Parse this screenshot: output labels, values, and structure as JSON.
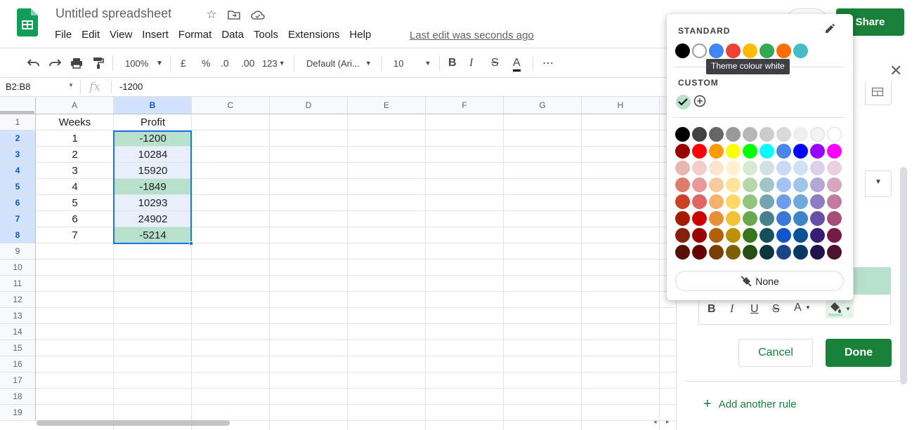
{
  "header": {
    "title": "Untitled spreadsheet",
    "menu": [
      "File",
      "Edit",
      "View",
      "Insert",
      "Format",
      "Data",
      "Tools",
      "Extensions",
      "Help"
    ],
    "last_edit": "Last edit was seconds ago",
    "share_label": "Share"
  },
  "toolbar": {
    "zoom": "100%",
    "currency": "£",
    "percent": "%",
    "dec_decrease": ".0",
    "dec_increase": ".00",
    "format_more": "123",
    "font": "Default (Ari...",
    "font_size": "10",
    "bold": "B",
    "italic": "I",
    "strike": "S",
    "text_color": "A",
    "more": "⋯"
  },
  "formula_bar": {
    "name_box": "B2:B8",
    "fx": "fx",
    "value": "-1200"
  },
  "grid": {
    "columns": [
      "A",
      "B",
      "C",
      "D",
      "E",
      "F",
      "G",
      "H"
    ],
    "rows": [
      "1",
      "2",
      "3",
      "4",
      "5",
      "6",
      "7",
      "8",
      "9",
      "10",
      "11",
      "12",
      "13",
      "14",
      "15",
      "16",
      "17",
      "18",
      "19"
    ],
    "col_a": [
      "Weeks",
      "1",
      "2",
      "3",
      "4",
      "5",
      "6",
      "7"
    ],
    "col_b": [
      "Profit",
      "-1200",
      "10284",
      "15920",
      "-1849",
      "10293",
      "24902",
      "-5214"
    ],
    "b_highlight": [
      true,
      false,
      false,
      true,
      false,
      false,
      true
    ]
  },
  "picker": {
    "standard_label": "STANDARD",
    "custom_label": "CUSTOM",
    "tooltip": "Theme colour white",
    "none_label": "None",
    "standard_colors": [
      "#000000",
      "#ffffff",
      "#4285f4",
      "#ea4335",
      "#fbbc04",
      "#34a853",
      "#ff6d01",
      "#46bdc6"
    ],
    "custom_colors": [
      "#b7e1cd"
    ],
    "palette": [
      [
        "#000000",
        "#434343",
        "#666666",
        "#999999",
        "#b7b7b7",
        "#cccccc",
        "#d9d9d9",
        "#efefef",
        "#f3f3f3",
        "#ffffff"
      ],
      [
        "#980000",
        "#ff0000",
        "#ff9900",
        "#ffff00",
        "#00ff00",
        "#00ffff",
        "#4a86e8",
        "#0000ff",
        "#9900ff",
        "#ff00ff"
      ],
      [
        "#e6b8af",
        "#f4cccc",
        "#fce5cd",
        "#fff2cc",
        "#d9ead3",
        "#d0e0e3",
        "#c9daf8",
        "#cfe2f3",
        "#d9d2e9",
        "#ead1dc"
      ],
      [
        "#dd7e6b",
        "#ea9999",
        "#f9cb9c",
        "#ffe599",
        "#b6d7a8",
        "#a2c4c9",
        "#a4c2f4",
        "#9fc5e8",
        "#b4a7d6",
        "#d5a6bd"
      ],
      [
        "#cc4125",
        "#e06666",
        "#f6b26b",
        "#ffd966",
        "#93c47d",
        "#76a5af",
        "#6d9eeb",
        "#6fa8dc",
        "#8e7cc3",
        "#c27ba0"
      ],
      [
        "#a61c00",
        "#cc0000",
        "#e69138",
        "#f1c232",
        "#6aa84f",
        "#45818e",
        "#3c78d8",
        "#3d85c6",
        "#674ea7",
        "#a64d79"
      ],
      [
        "#85200c",
        "#990000",
        "#b45f06",
        "#bf9000",
        "#38761d",
        "#134f5c",
        "#1155cc",
        "#0b5394",
        "#351c75",
        "#741b47"
      ],
      [
        "#5b0f00",
        "#660000",
        "#783f04",
        "#7f6000",
        "#274e13",
        "#0c343d",
        "#1c4587",
        "#073763",
        "#20124d",
        "#4c1130"
      ]
    ]
  },
  "panel": {
    "cancel_label": "Cancel",
    "done_label": "Done",
    "add_rule_label": "Add another rule",
    "fmt": {
      "bold": "B",
      "italic": "I",
      "underline": "U",
      "strike": "S",
      "color": "A"
    }
  },
  "colors": {
    "accent": "#188038",
    "highlight": "#b7e1cd",
    "selection": "#e8f0fe",
    "selection_border": "#1a73e8"
  }
}
